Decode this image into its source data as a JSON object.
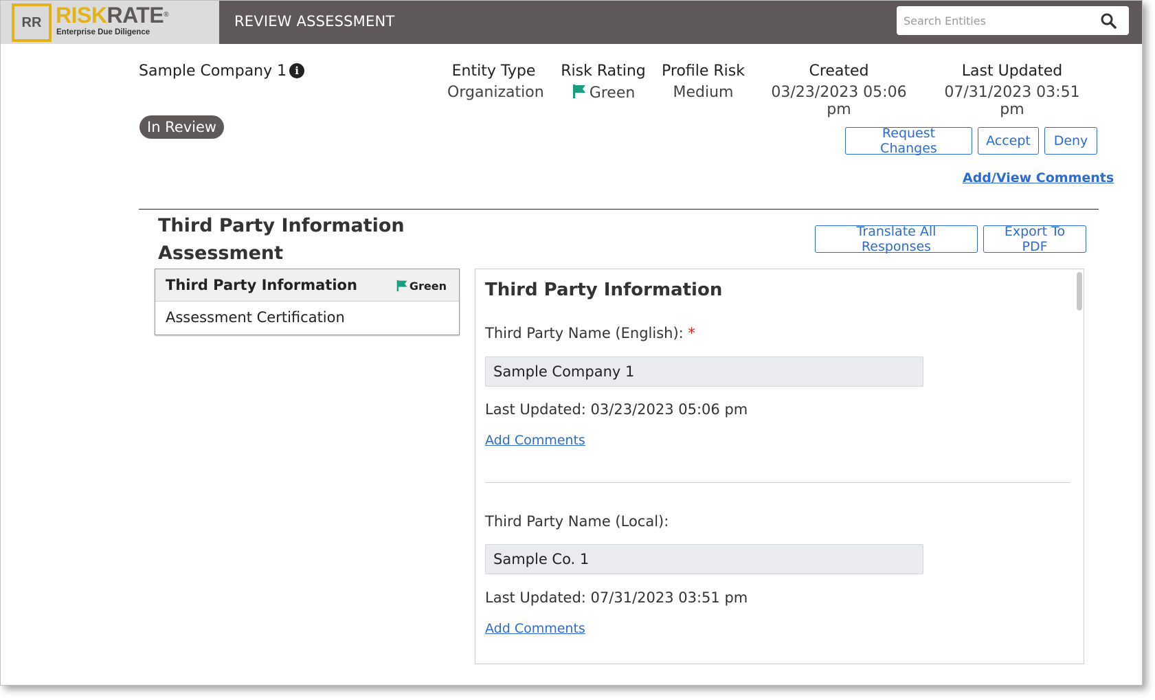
{
  "header": {
    "logo_mark": "RR",
    "logo_word_a": "RISK",
    "logo_word_b": "RATE",
    "logo_reg": "®",
    "logo_tagline": "Enterprise Due Diligence",
    "page_title": "REVIEW ASSESSMENT",
    "search_placeholder": "Search Entities",
    "search_icon": "magnifier-icon"
  },
  "entity": {
    "name": "Sample Company 1",
    "info_icon": "info-circle-icon",
    "status": "In Review",
    "meta": [
      {
        "label": "Entity Type",
        "value": "Organization"
      },
      {
        "label": "Risk Rating",
        "value": "Green",
        "flag_color": "#1a9e80"
      },
      {
        "label": "Profile Risk",
        "value": "Medium"
      },
      {
        "label": "Created",
        "value": "03/23/2023 05:06 pm"
      },
      {
        "label": "Last Updated",
        "value": "07/31/2023 03:51 pm"
      }
    ]
  },
  "actions": {
    "request_changes": "Request Changes",
    "accept": "Accept",
    "deny": "Deny",
    "view_comments": "Add/View Comments"
  },
  "section": {
    "title": "Third Party Information Assessment",
    "translate": "Translate All Responses",
    "export": "Export To PDF"
  },
  "nav": {
    "items": [
      {
        "label": "Third Party Information",
        "badge": "Green"
      },
      {
        "label": "Assessment Certification"
      }
    ]
  },
  "panel": {
    "title": "Third Party Information",
    "fields": [
      {
        "label": "Third Party Name (English):",
        "required_mark": "*",
        "value": "Sample Company 1",
        "updated": "Last Updated: 03/23/2023 05:06 pm",
        "comment_link": "Add Comments"
      },
      {
        "label": "Third Party Name (Local):",
        "value": "Sample Co. 1",
        "updated": "Last Updated: 07/31/2023 03:51 pm",
        "comment_link": "Add Comments"
      }
    ]
  },
  "colors": {
    "topbar": "#5e5858",
    "logo_yellow": "#e3b219",
    "link_blue": "#2c6bd4",
    "flag_green": "#1a9e80"
  }
}
